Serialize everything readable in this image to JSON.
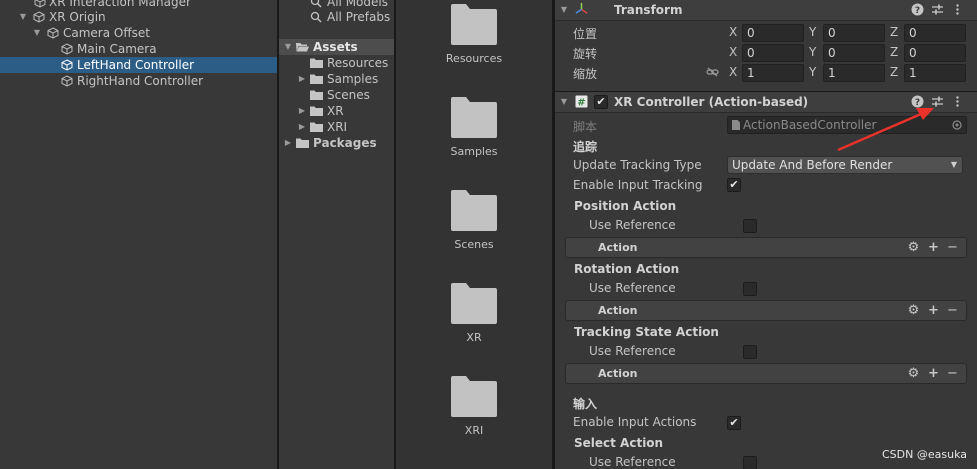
{
  "hierarchy": {
    "items": [
      {
        "label": "XR Interaction Manager"
      },
      {
        "label": "XR Origin"
      },
      {
        "label": "Camera Offset"
      },
      {
        "label": "Main Camera"
      },
      {
        "label": "LeftHand Controller"
      },
      {
        "label": "RightHand Controller"
      }
    ]
  },
  "project": {
    "favorites": [
      {
        "label": "All Models"
      },
      {
        "label": "All Prefabs"
      }
    ],
    "assets_label": "Assets",
    "asset_folders": [
      {
        "label": "Resources"
      },
      {
        "label": "Samples"
      },
      {
        "label": "Scenes"
      },
      {
        "label": "XR"
      },
      {
        "label": "XRI"
      }
    ],
    "packages_label": "Packages"
  },
  "grid": {
    "tiles": [
      {
        "label": "Resources"
      },
      {
        "label": "Samples"
      },
      {
        "label": "Scenes"
      },
      {
        "label": "XR"
      },
      {
        "label": "XRI"
      }
    ]
  },
  "inspector": {
    "transform": {
      "title": "Transform",
      "rows": [
        {
          "label": "位置",
          "x": "0",
          "y": "0",
          "z": "0"
        },
        {
          "label": "旋转",
          "x": "0",
          "y": "0",
          "z": "0"
        },
        {
          "label": "缩放",
          "x": "1",
          "y": "1",
          "z": "1"
        }
      ],
      "axis": {
        "x": "X",
        "y": "Y",
        "z": "Z"
      }
    },
    "xr_controller": {
      "title": "XR Controller (Action-based)",
      "enabled": true,
      "script_label": "脚本",
      "script_value": "ActionBasedController",
      "tracking_header": "追踪",
      "update_tracking_type_label": "Update Tracking Type",
      "update_tracking_type_value": "Update And Before Render",
      "enable_input_tracking_label": "Enable Input Tracking",
      "enable_input_tracking": true,
      "position_action": {
        "header": "Position Action",
        "use_reference": "Use Reference",
        "action": "Action"
      },
      "rotation_action": {
        "header": "Rotation Action",
        "use_reference": "Use Reference",
        "action": "Action"
      },
      "tracking_state_action": {
        "header": "Tracking State Action",
        "use_reference": "Use Reference",
        "action": "Action"
      },
      "input_header": "输入",
      "enable_input_actions_label": "Enable Input Actions",
      "enable_input_actions": true,
      "select_action": {
        "header": "Select Action",
        "use_reference": "Use Reference"
      }
    }
  },
  "watermark": "CSDN @easuka",
  "colors": {
    "selection": "#2c5d87",
    "annotation_arrow": "#e8322a"
  }
}
